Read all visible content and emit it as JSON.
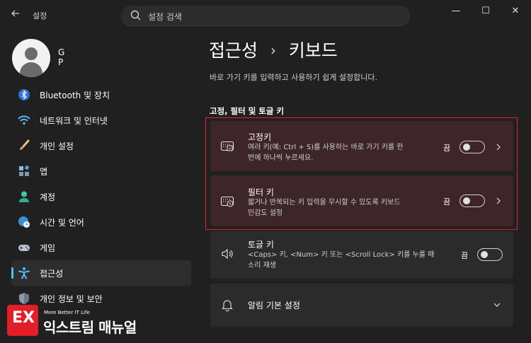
{
  "titlebar": {
    "back_icon": "back-arrow-icon",
    "app_title": "설정",
    "search_placeholder": "설정 검색",
    "minimize_glyph": "—",
    "maximize_glyph": "☐",
    "close_glyph": "✕"
  },
  "profile": {
    "name": "G P"
  },
  "sidebar": {
    "items": [
      {
        "label": "Bluetooth 및 장치",
        "icon": "bluetooth-icon"
      },
      {
        "label": "네트워크 및 인터넷",
        "icon": "wifi-icon"
      },
      {
        "label": "개인 설정",
        "icon": "paintbrush-icon"
      },
      {
        "label": "앱",
        "icon": "apps-icon"
      },
      {
        "label": "계정",
        "icon": "account-icon"
      },
      {
        "label": "시간 및 언어",
        "icon": "globe-clock-icon"
      },
      {
        "label": "게임",
        "icon": "gamepad-icon"
      },
      {
        "label": "접근성",
        "icon": "accessibility-icon",
        "active": true
      },
      {
        "label": "개인 정보 및 보안",
        "icon": "shield-icon"
      }
    ]
  },
  "main": {
    "breadcrumb_parent": "접근성",
    "breadcrumb_sep": "›",
    "breadcrumb_current": "키보드",
    "description": "바로 가기 키를 입력하고 사용하기 쉽게 설정합니다.",
    "section_title": "고정, 필터 및 토글 키",
    "cards": [
      {
        "title": "고정키",
        "subtitle_line1": "여러 키(예: Ctrl + S)를 사용하는 바로 가기 키를 한",
        "subtitle_line2": "번에 하나씩 누르세요.",
        "state": "끔",
        "toggle_on": false,
        "icon": "sticky-keys-icon"
      },
      {
        "title": "필터 키",
        "subtitle_line1": "짧거나 반복되는 키 입력을 무시할 수 있도록 키보드",
        "subtitle_line2": "민감도 설정",
        "state": "끔",
        "toggle_on": false,
        "icon": "filter-keys-icon"
      },
      {
        "title": "토글 키",
        "subtitle_line1": "<Caps> 키, <Num> 키 또는 <Scroll Lock> 키를 누를 때",
        "subtitle_line2": "소리 재생",
        "state": "끔",
        "toggle_on": false,
        "icon": "speaker-icon"
      },
      {
        "title": "알림 기본 설정",
        "icon": "bell-icon"
      }
    ]
  },
  "watermark": {
    "tagline": "More Better IT Life",
    "brand": "익스트림 매뉴얼",
    "logo_letters": "EX"
  },
  "colors": {
    "accent": "#4cc2ff",
    "highlight_border": "#e0212e",
    "logo_red": "#e21f26"
  }
}
